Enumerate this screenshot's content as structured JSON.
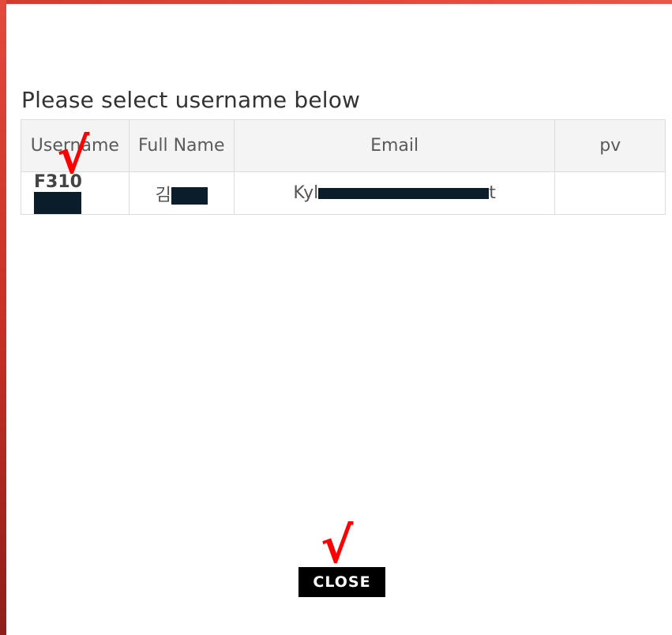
{
  "dialog": {
    "heading": "Please select username below",
    "table": {
      "columns": [
        "Username",
        "Full Name",
        "Email",
        "pv"
      ],
      "rows": [
        {
          "username_visible": "F310",
          "fullname_visible": "김",
          "email_prefix": "Kyl",
          "email_suffix": "t",
          "pv": ""
        }
      ]
    },
    "close_label": "CLOSE",
    "annotation_mark": "√"
  },
  "colors": {
    "frame": "#d63a2c",
    "annotation": "#ff0000",
    "redaction": "#0b1d2a",
    "button_bg": "#000000"
  }
}
